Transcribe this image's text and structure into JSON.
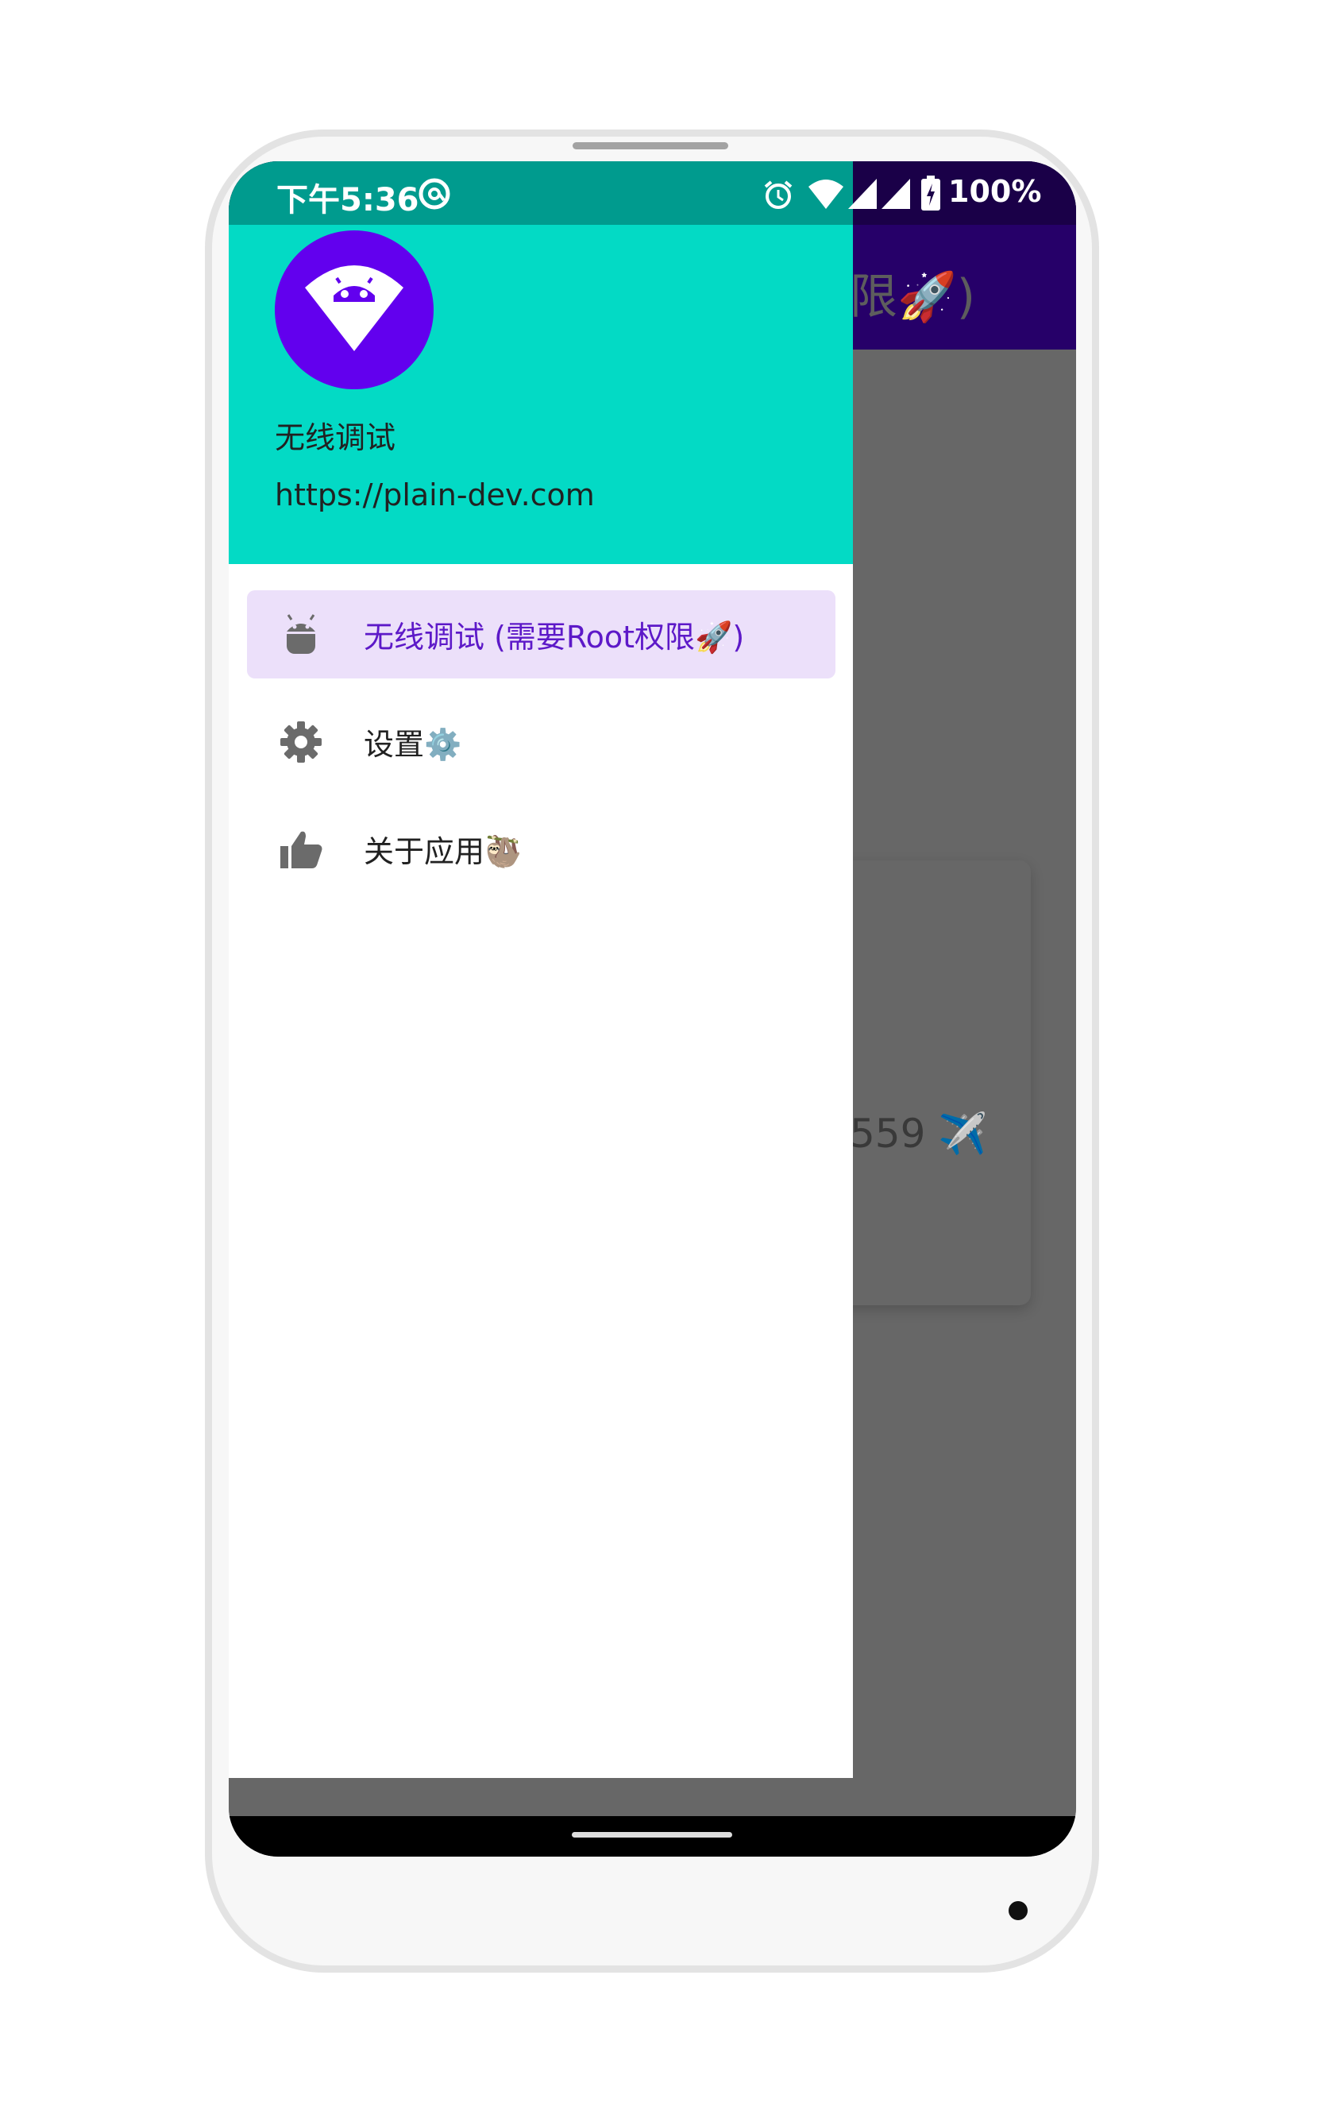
{
  "status_bar": {
    "time": "下午5:36",
    "battery": "100%",
    "icons": [
      "at-sign-icon",
      "alarm-icon",
      "wifi-icon",
      "signal-icon",
      "signal-icon",
      "battery-icon"
    ]
  },
  "background_app": {
    "title_fragment": "限🚀)",
    "card_text_fragment": "559 ✈️"
  },
  "drawer": {
    "header": {
      "app_name": "无线调试",
      "url": "https://plain-dev.com",
      "avatar_icon": "android-wifi-icon"
    },
    "items": [
      {
        "label": "无线调试 (需要Root权限🚀)",
        "icon": "android-icon",
        "active": true
      },
      {
        "label": "设置⚙️",
        "icon": "gear-icon",
        "active": false
      },
      {
        "label": "关于应用🦥",
        "icon": "thumbs-up-icon",
        "active": false
      }
    ]
  },
  "colors": {
    "status_bar_drawer": "#009b8e",
    "drawer_header": "#03dac5",
    "avatar": "#6200ee",
    "active_item_bg": "#ece0fa",
    "active_item_text": "#5d19c8",
    "app_bar_dimmed": "#260069",
    "scrim": "#676767"
  }
}
